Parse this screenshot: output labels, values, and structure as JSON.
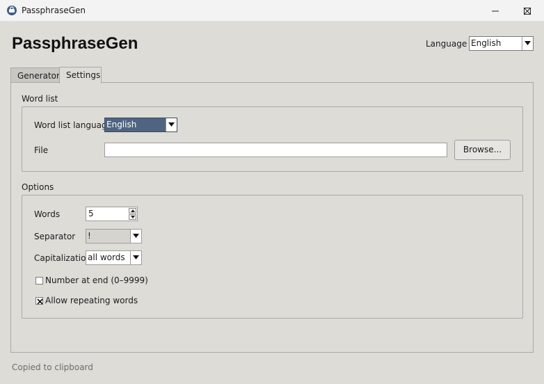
{
  "window": {
    "title": "PassphraseGen"
  },
  "header": {
    "app_title": "PassphraseGen",
    "language_label": "Language",
    "language_value": "English"
  },
  "tabs": [
    {
      "label": "Generator",
      "active": false
    },
    {
      "label": "Settings",
      "active": true
    }
  ],
  "word_list": {
    "group_title": "Word list",
    "language_label": "Word list language",
    "language_value": "English",
    "file_label": "File",
    "file_value": "",
    "browse_label": "Browse..."
  },
  "options": {
    "group_title": "Options",
    "words_label": "Words",
    "words_value": "5",
    "separator_label": "Separator",
    "separator_value": "!",
    "capitalization_label": "Capitalization",
    "capitalization_value": "all words",
    "number_at_end_label": "Number at end (0–9999)",
    "number_at_end_checked": false,
    "allow_repeating_label": "Allow repeating words",
    "allow_repeating_checked": true
  },
  "status": {
    "text": "Copied to clipboard"
  },
  "icons": {
    "app": "app-icon",
    "minimize": "minimize-icon",
    "maximize": "maximize-icon",
    "close": "close-icon",
    "dropdown": "chevron-down-icon",
    "spin_up": "spin-up-icon",
    "spin_down": "spin-down-icon",
    "checkmark": "checkmark-icon"
  },
  "colors": {
    "window_bg": "#dedcd7",
    "selection": "#4f6480",
    "titlebar_bg": "#f3f3f3"
  }
}
